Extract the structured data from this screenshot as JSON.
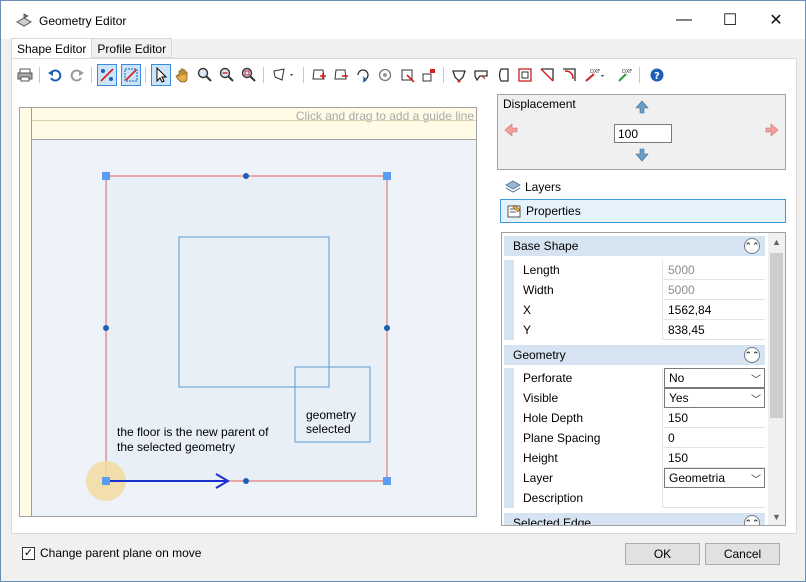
{
  "window": {
    "title": "Geometry Editor",
    "minimize_glyph": "—",
    "maximize_glyph": "☐",
    "close_glyph": "✕"
  },
  "tabs": [
    {
      "label": "Shape Editor",
      "active": true
    },
    {
      "label": "Profile Editor",
      "active": false
    }
  ],
  "toolbar": {
    "icons": [
      "print-icon",
      "undo-icon",
      "redo-icon",
      "snap-icon",
      "snap-off-icon",
      "select-pointer-icon",
      "pan-hand-icon",
      "zoom-icon",
      "zoom-out-icon",
      "zoom-fit-icon",
      "shape-dropdown-icon",
      "add-point-icon",
      "remove-point-icon",
      "rotate-icon",
      "circle-op-icon",
      "trim-icon",
      "align-icon",
      "polygon-icon",
      "cut-icon",
      "edge-icon",
      "frame-icon",
      "diagonal-icon",
      "corner-icon",
      "dxf-export-icon",
      "dxf-import-icon",
      "help-icon"
    ]
  },
  "canvas": {
    "guide_hint": "Click and drag to add a guide line",
    "annotation_parent": [
      "the floor is the new parent of",
      "the selected geometry"
    ],
    "annotation_geometry": [
      "geometry",
      "selected"
    ]
  },
  "displacement": {
    "label": "Displacement",
    "value": "100"
  },
  "side_panel": {
    "layers_label": "Layers",
    "properties_label": "Properties"
  },
  "properties": {
    "base_shape": {
      "title": "Base Shape",
      "rows": [
        {
          "key": "Length",
          "value": "5000"
        },
        {
          "key": "Width",
          "value": "5000"
        },
        {
          "key": "X",
          "value": "1562,84"
        },
        {
          "key": "Y",
          "value": "838,45"
        }
      ]
    },
    "geometry": {
      "title": "Geometry",
      "rows": [
        {
          "key": "Perforate",
          "value": "No"
        },
        {
          "key": "Visible",
          "value": "Yes"
        },
        {
          "key": "Hole Depth",
          "value": "150"
        },
        {
          "key": "Plane Spacing",
          "value": "0"
        },
        {
          "key": "Height",
          "value": "150"
        },
        {
          "key": "Layer",
          "value": "Geometria"
        },
        {
          "key": "Description",
          "value": ""
        }
      ]
    },
    "selected_edge": {
      "title": "Selected Edge"
    }
  },
  "footer": {
    "checkbox_label": "Change parent plane on move",
    "checkbox_checked": true,
    "ok_label": "OK",
    "cancel_label": "Cancel"
  }
}
